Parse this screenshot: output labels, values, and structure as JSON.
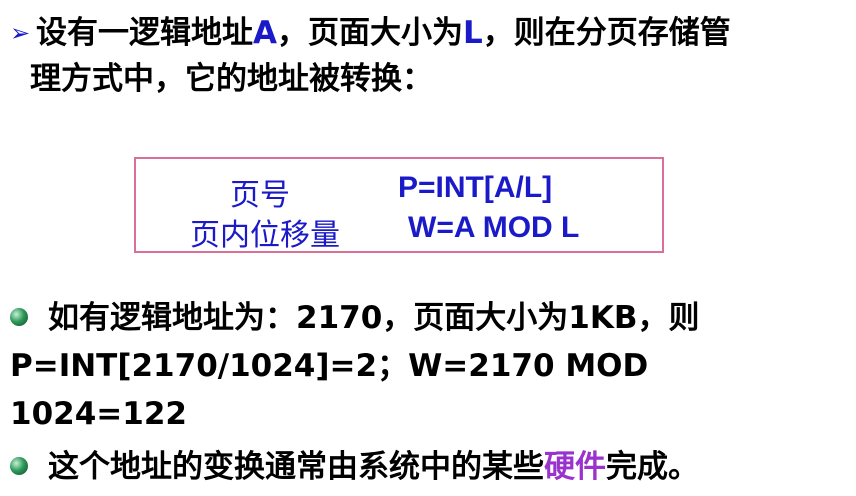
{
  "intro": {
    "prefix": "设有一逻辑地址",
    "var_a": "A",
    "middle": "，页面大小为",
    "var_l": "L",
    "suffix": "，则在分页存储管",
    "line2": "理方式中，它的地址被转换："
  },
  "formulas": {
    "page_label": "页号",
    "page_expr": "P=INT[A/L]",
    "offset_label": "页内位移量",
    "offset_expr": "W=A MOD L"
  },
  "example": {
    "line1": "如有逻辑地址为：2170，页面大小为1KB，则",
    "line2": "P=INT[2170/1024]=2；W=2170 MOD",
    "line3": "1024=122"
  },
  "conclusion": {
    "prefix": "这个地址的变换通常由系统中的某些",
    "highlight": "硬件",
    "suffix": "完成。"
  },
  "colors": {
    "accent_blue": "#1a1ac8",
    "highlight_purple": "#9933cc",
    "box_border": "#d8709a",
    "bullet": "#2e9a5a"
  },
  "icons": {
    "arrow": "arrow-bullet-icon",
    "bullet": "green-sphere-bullet-icon"
  }
}
